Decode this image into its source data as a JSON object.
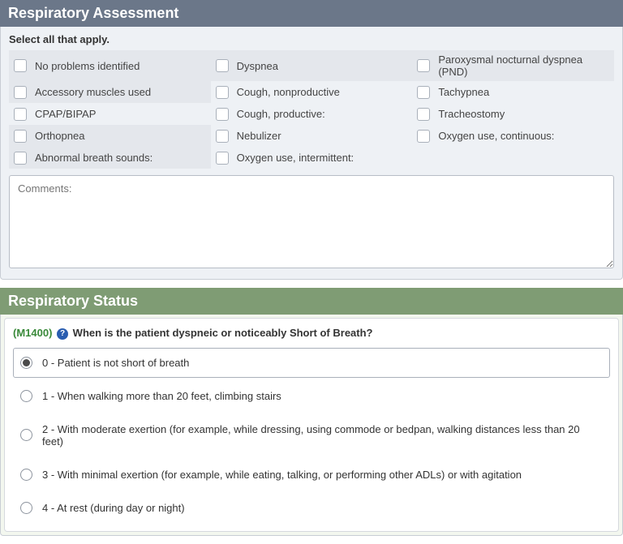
{
  "assessment": {
    "title": "Respiratory Assessment",
    "instruction": "Select all that apply.",
    "items": [
      {
        "label": "No problems identified",
        "shaded": true
      },
      {
        "label": "Dyspnea",
        "shaded": true
      },
      {
        "label": "Paroxysmal nocturnal dyspnea (PND)",
        "shaded": true
      },
      {
        "label": "Accessory muscles used",
        "shaded": true
      },
      {
        "label": "Cough, nonproductive",
        "shaded": false
      },
      {
        "label": "Tachypnea",
        "shaded": false
      },
      {
        "label": "CPAP/BIPAP",
        "shaded": false
      },
      {
        "label": "Cough, productive:",
        "shaded": false
      },
      {
        "label": "Tracheostomy",
        "shaded": false
      },
      {
        "label": "Orthopnea",
        "shaded": true
      },
      {
        "label": "Nebulizer",
        "shaded": false
      },
      {
        "label": "Oxygen use, continuous:",
        "shaded": false
      },
      {
        "label": "Abnormal breath sounds:",
        "shaded": true
      },
      {
        "label": "Oxygen use, intermittent:",
        "shaded": false
      }
    ],
    "comments_placeholder": "Comments:"
  },
  "status": {
    "title": "Respiratory Status",
    "code": "(M1400)",
    "help_glyph": "?",
    "question": "When is the patient dyspneic or noticeably Short of Breath?",
    "options": [
      {
        "label": "0 - Patient is not short of breath",
        "selected": true
      },
      {
        "label": "1 - When walking more than 20 feet, climbing stairs",
        "selected": false
      },
      {
        "label": "2 - With moderate exertion (for example, while dressing, using commode or bedpan, walking distances less than 20 feet)",
        "selected": false
      },
      {
        "label": "3 - With minimal exertion (for example, while eating, talking, or performing other ADLs) or with agitation",
        "selected": false
      },
      {
        "label": "4 - At rest (during day or night)",
        "selected": false
      }
    ]
  }
}
